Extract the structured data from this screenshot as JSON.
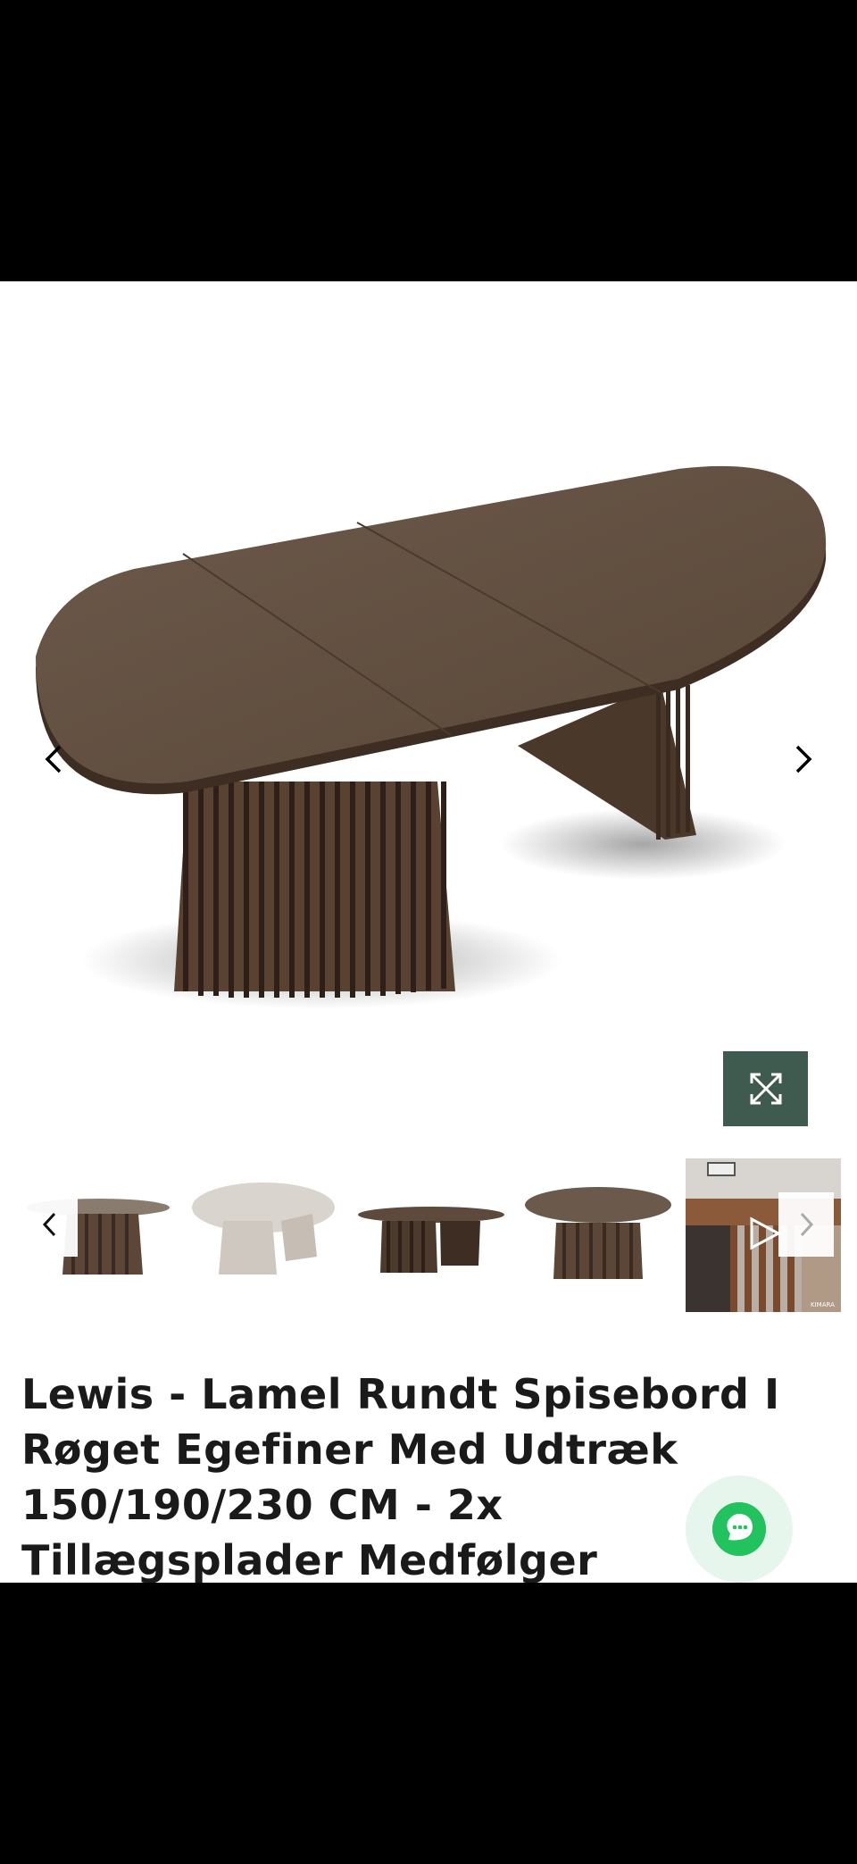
{
  "product": {
    "title": "Lewis - Lamel Rundt Spisebord I Røget Egefiner Med Udtræk 150/190/230 CM - 2x Tillægsplader Medfølger"
  },
  "gallery": {
    "prev_icon": "chevron-left-icon",
    "next_icon": "chevron-right-icon",
    "expand_icon": "expand-arrows-icon",
    "thumbnail_brand_text": "KIMARA"
  },
  "colors": {
    "wood": "#5b4637",
    "wood_dark": "#3e2d22",
    "expand_bg": "#3f5a4f",
    "chat_green": "#22c35e"
  },
  "chat": {
    "icon": "chat-bubble-icon"
  }
}
